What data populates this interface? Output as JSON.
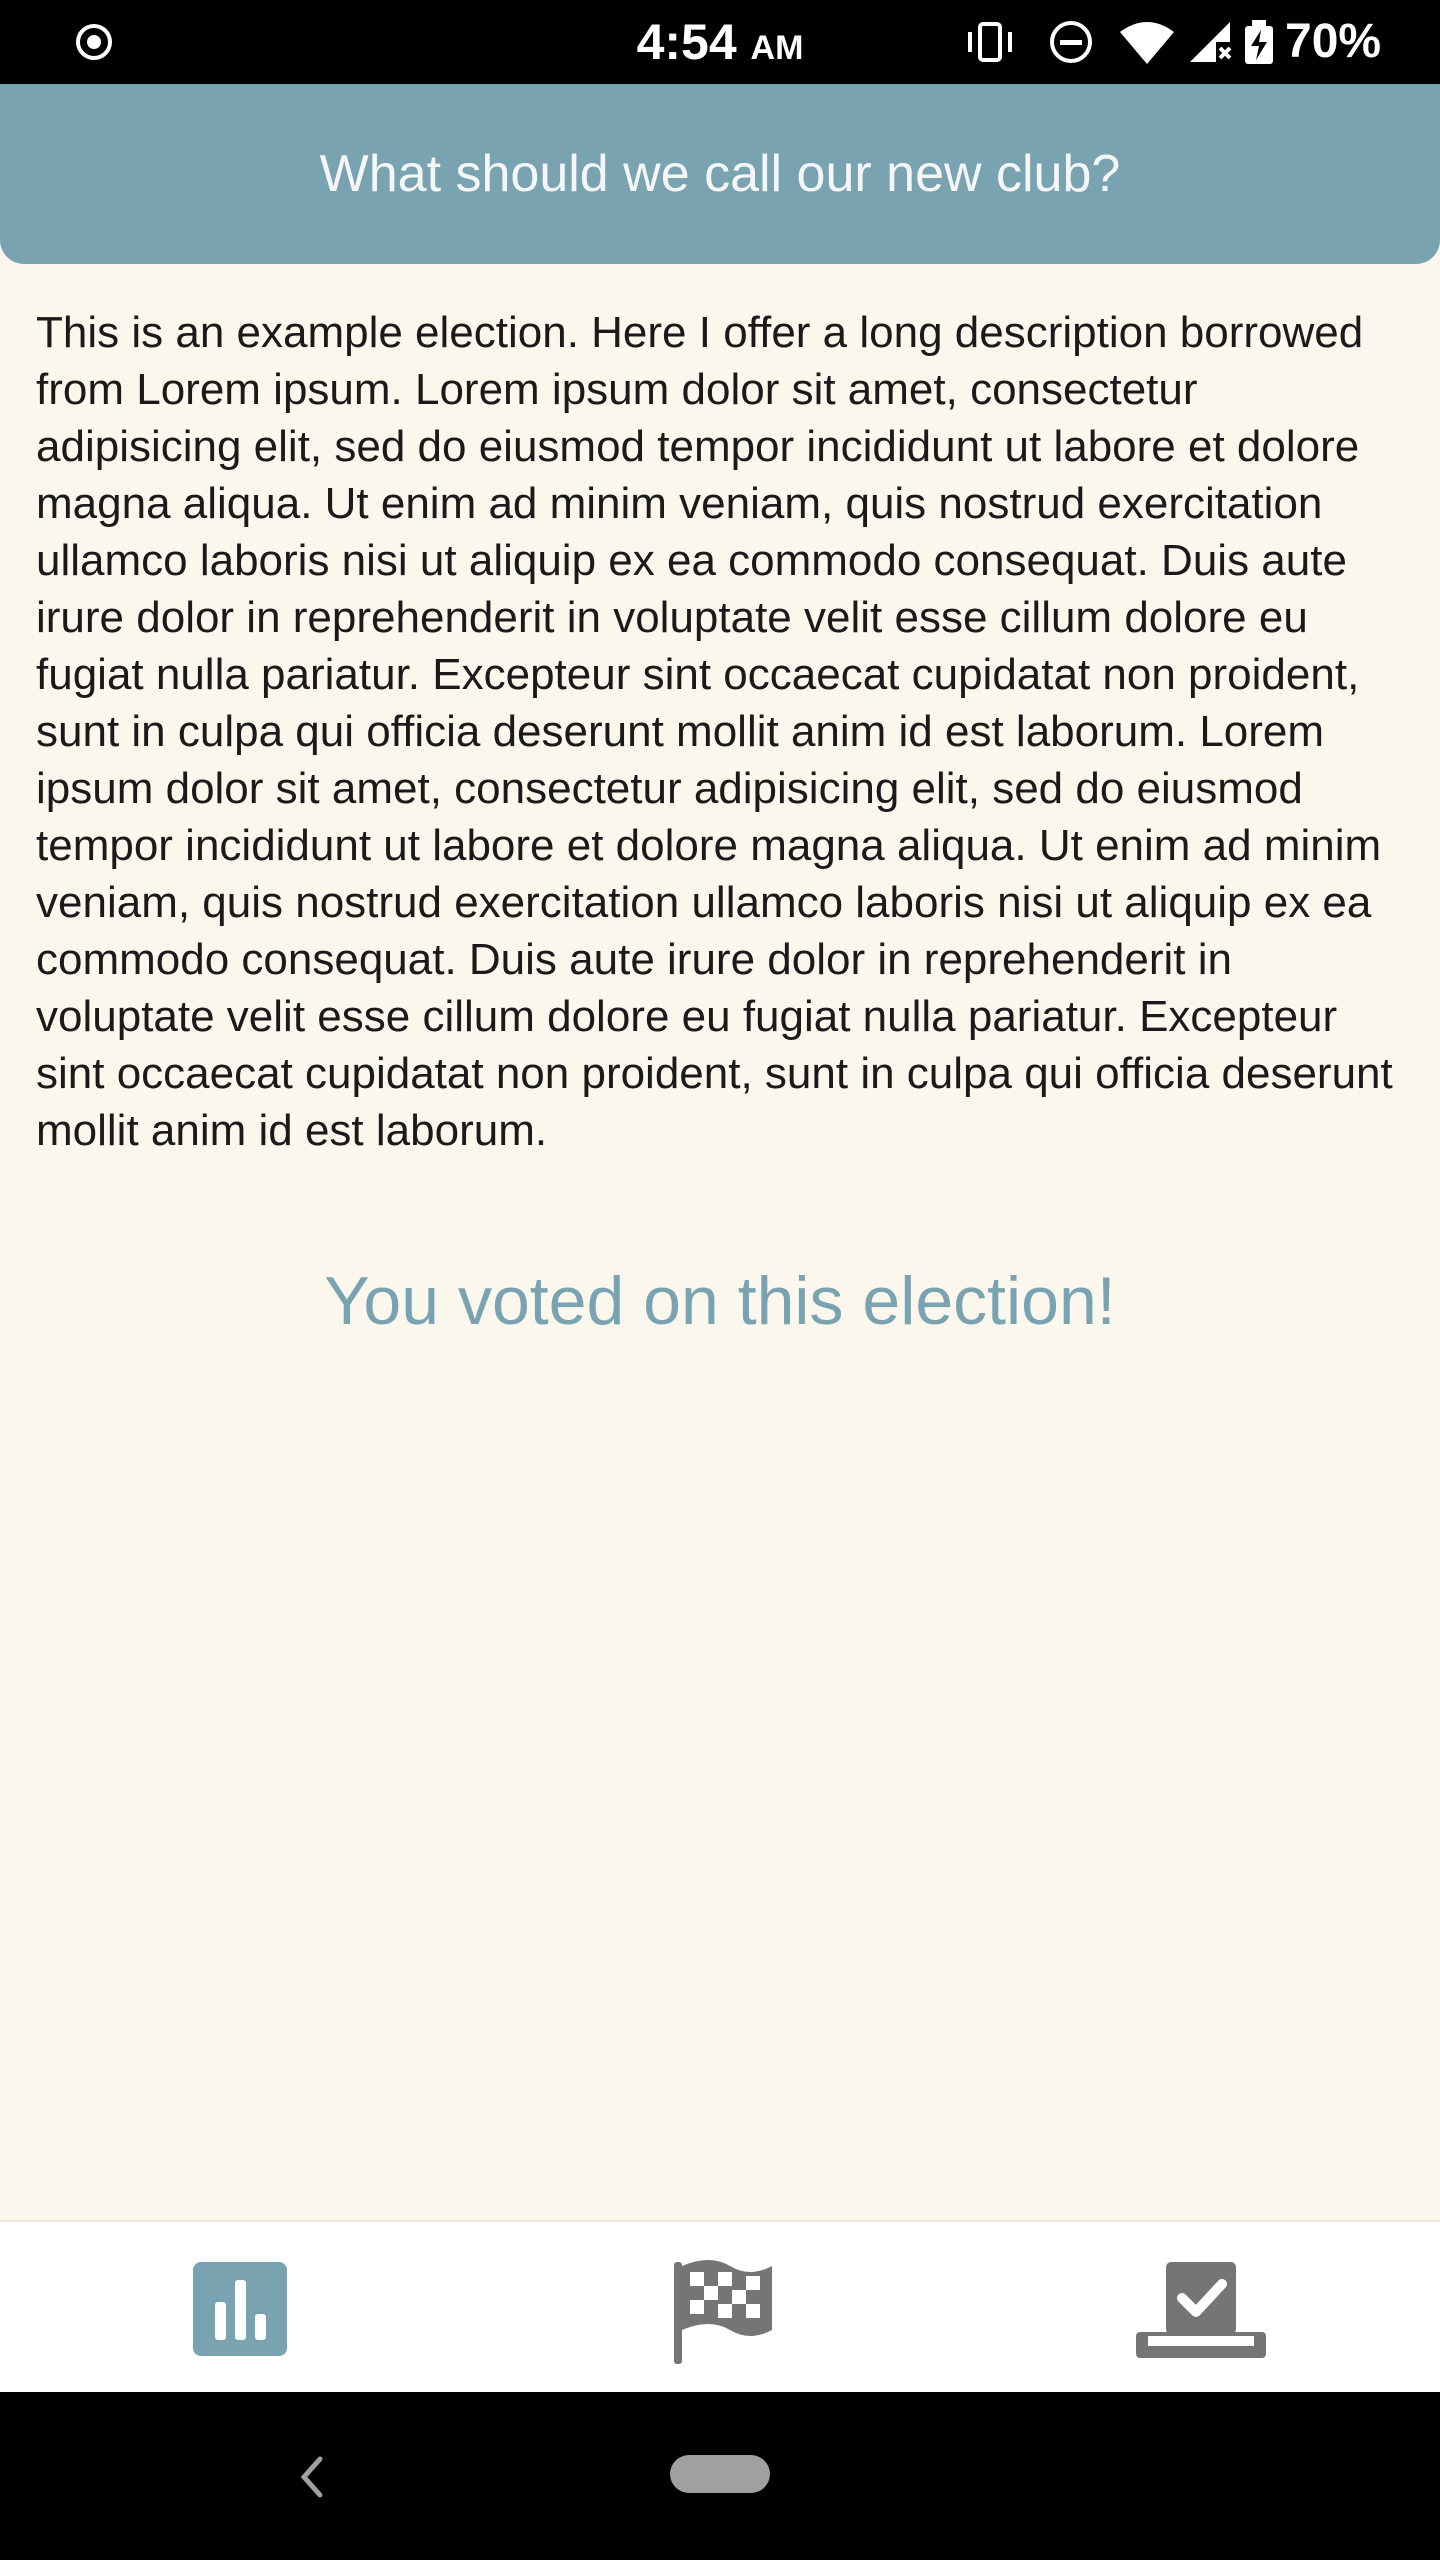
{
  "status_bar": {
    "time": "4:54",
    "ampm": "AM",
    "battery": "70%",
    "icons": [
      "cast-icon",
      "vibrate-icon",
      "do-not-disturb-icon",
      "wifi-icon",
      "signal-icon",
      "battery-charging-icon"
    ]
  },
  "header": {
    "title": "What should we call our new club?"
  },
  "election": {
    "description": "This is an example election. Here I offer a long description borrowed from Lorem ipsum. Lorem ipsum dolor sit amet, consectetur adipisicing elit, sed do eiusmod tempor incididunt ut labore et dolore magna aliqua. Ut enim ad minim veniam, quis nostrud exercitation ullamco laboris nisi ut aliquip ex ea commodo consequat. Duis aute irure dolor in reprehenderit in voluptate velit esse cillum dolore eu fugiat nulla pariatur. Excepteur sint occaecat cupidatat non proident, sunt in culpa qui officia deserunt mollit anim id est laborum. Lorem ipsum dolor sit amet, consectetur adipisicing elit, sed do eiusmod tempor incididunt ut labore et dolore magna aliqua. Ut enim ad minim veniam, quis nostrud exercitation ullamco laboris nisi ut aliquip ex ea commodo consequat. Duis aute irure dolor in reprehenderit in voluptate velit esse cillum dolore eu fugiat nulla pariatur. Excepteur sint occaecat cupidatat non proident, sunt in culpa qui officia deserunt mollit anim id est laborum.",
    "voted_message": "You voted on this election!"
  },
  "bottom_nav": {
    "items": [
      {
        "icon": "bar-chart-icon",
        "active": true
      },
      {
        "icon": "checkered-flag-icon",
        "active": false
      },
      {
        "icon": "ballot-box-icon",
        "active": false
      }
    ]
  },
  "colors": {
    "accent": "#7aa3b2",
    "background": "#fbf7ec",
    "inactive_icon": "#757575"
  }
}
